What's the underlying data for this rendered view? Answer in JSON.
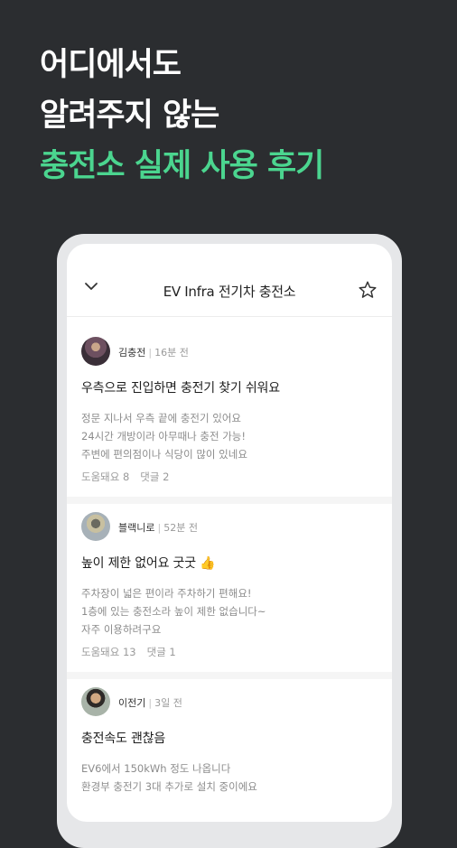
{
  "headline": {
    "line1": "어디에서도",
    "line2": "알려주지 않는",
    "line3": "충전소 실제 사용 후기"
  },
  "colors": {
    "background": "#2b2d30",
    "accent_green": "#4bd58f",
    "phone_frame": "#e6e7e9"
  },
  "appbar": {
    "back_icon": "chevron-down-icon",
    "title": "EV Infra 전기차 충전소",
    "favorite_icon": "star-outline-icon"
  },
  "reviews": [
    {
      "author": "김충전",
      "time": "16분 전",
      "title": "우측으로 진입하면 충전기 찾기 쉬워요",
      "body": [
        "정문 지나서 우측 끝에 충전기 있어요",
        "24시간 개방이라 아무때나 충전 가능!",
        "주변에 편의점이나 식당이 많이 있네요"
      ],
      "helpful": "도움돼요 8",
      "comments": "댓글 2"
    },
    {
      "author": "블랙니로",
      "time": "52분 전",
      "title": "높이 제한 없어요 굿굿 👍",
      "body": [
        "주차장이 넓은 편이라 주차하기 편해요!",
        "1층에 있는 충전소라 높이 제한 없습니다~",
        "자주 이용하려구요"
      ],
      "helpful": "도움돼요 13",
      "comments": "댓글 1"
    },
    {
      "author": "이전기",
      "time": "3일 전",
      "title": "충전속도 괜찮음",
      "body": [
        "EV6에서 150kWh 정도 나옵니다",
        "환경부 충전기 3대 추가로 설치 중이에요"
      ]
    }
  ]
}
